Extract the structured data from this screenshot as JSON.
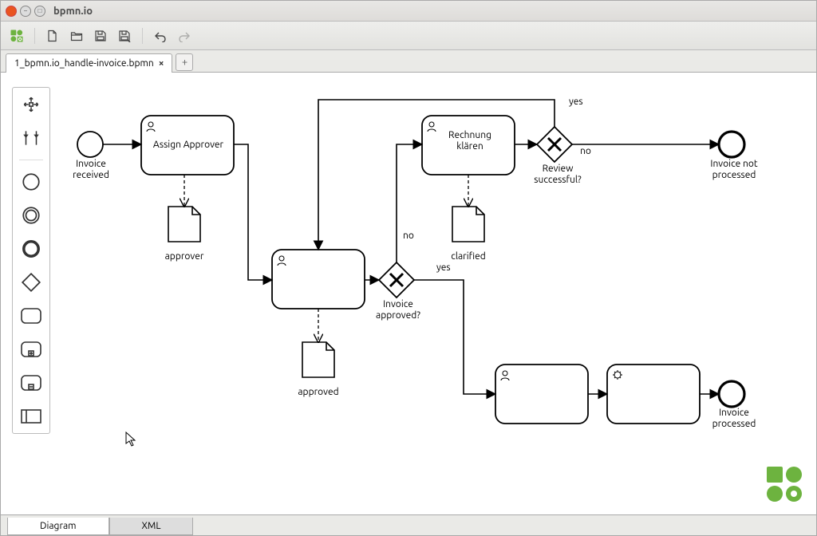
{
  "window": {
    "title": "bpmn.io"
  },
  "tabs": {
    "file": "1_bpmn.io_handle-invoice.bpmn",
    "add": "+"
  },
  "bottomTabs": {
    "diagram": "Diagram",
    "xml": "XML"
  },
  "diagram": {
    "startEvent": "Invoice\nreceived",
    "task_assign": "Assign Approver",
    "data_approver": "approver",
    "task_approve": "",
    "data_approved": "approved",
    "gateway_approved": "Invoice\napproved?",
    "edge_no": "no",
    "task_clarify": "Rechnung\nklären",
    "data_clarified": "clarified",
    "edge_yes_clar": "yes",
    "gateway_review": "Review\nsuccessful?",
    "edge_review_yes": "yes",
    "edge_review_no": "no",
    "end_notprocessed": "Invoice not\nprocessed",
    "task_user_bottom": "",
    "task_service_bottom": "",
    "end_processed": "Invoice\nprocessed"
  }
}
